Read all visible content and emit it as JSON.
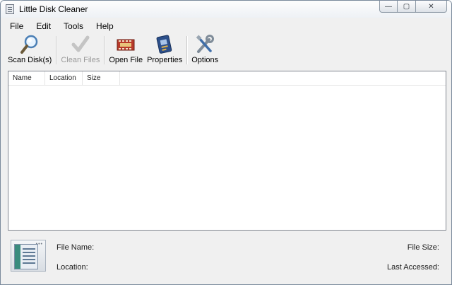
{
  "window": {
    "title": "Little Disk Cleaner",
    "controls": {
      "minimize": "—",
      "maximize": "▢",
      "close": "✕"
    }
  },
  "menu": {
    "file": "File",
    "edit": "Edit",
    "tools": "Tools",
    "help": "Help"
  },
  "toolbar": {
    "scan": "Scan Disk(s)",
    "clean": "Clean Files",
    "open": "Open File",
    "properties": "Properties",
    "options": "Options"
  },
  "list": {
    "columns": {
      "name": "Name",
      "location": "Location",
      "size": "Size"
    }
  },
  "info": {
    "file_name": "File Name:",
    "location": "Location:",
    "file_size": "File Size:",
    "last_accessed": "Last Accessed:"
  },
  "icons": {
    "scan": "magnifier-icon",
    "clean": "checkmark-icon",
    "open": "film-file-icon",
    "properties": "chip-card-icon",
    "options": "tools-icon"
  }
}
